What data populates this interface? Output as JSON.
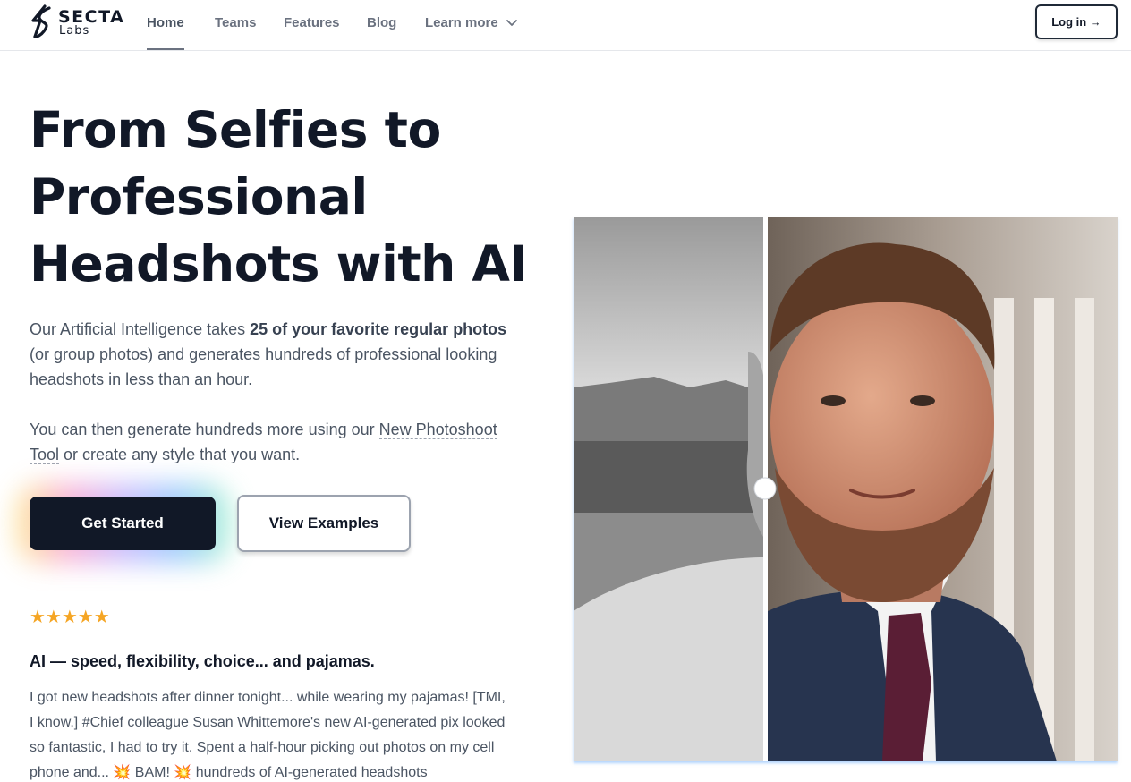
{
  "brand": {
    "name": "SECTA",
    "sub": "Labs"
  },
  "nav": {
    "items": [
      {
        "label": "Home",
        "active": true
      },
      {
        "label": "Teams"
      },
      {
        "label": "Features"
      },
      {
        "label": "Blog"
      },
      {
        "label": "Learn more",
        "has_dropdown": true
      }
    ],
    "login_label": "Log in →"
  },
  "hero": {
    "headline_lines": [
      "From Selfies to",
      "Professional",
      "Headshots with AI"
    ],
    "para1": {
      "pre": "Our Artificial Intelligence takes ",
      "bold": "25 of your favorite regular photos",
      "post": " (or group photos) and generates hundreds of professional looking headshots in less than an hour."
    },
    "para2": {
      "pre": "You can then generate hundreds more using our ",
      "link": "New Photoshoot Tool",
      "post": " or create any style that you want."
    },
    "primary_button": "Get Started",
    "secondary_button": "View Examples"
  },
  "review": {
    "rating": 5,
    "stars": "★★★★★",
    "title": "AI — speed, flexibility, choice... and pajamas.",
    "body": "I got new headshots after dinner tonight... while wearing my pajamas! [TMI, I know.] #Chief colleague Susan Whittemore's new AI-generated pix looked so fantastic, I had to try it. Spent a half-hour picking out photos on my cell phone and... 💥 BAM! 💥 hundreds of AI-generated headshots"
  },
  "compare": {
    "before_label": "selfie-before",
    "after_label": "headshot-after",
    "slider_position": 0.35
  },
  "colors": {
    "primary": "#111827",
    "muted_text": "#4b5563",
    "star": "#f5a524"
  }
}
